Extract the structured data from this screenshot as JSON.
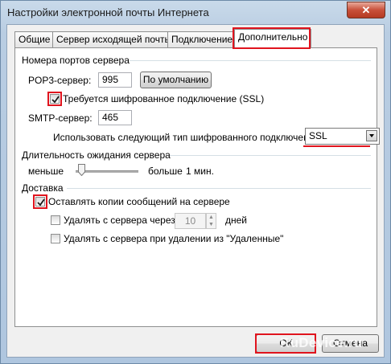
{
  "window": {
    "title": "Настройки электронной почты Интернета",
    "close_label": "✕"
  },
  "tabs": [
    {
      "label": "Общие"
    },
    {
      "label": "Сервер исходящей почты"
    },
    {
      "label": "Подключение"
    },
    {
      "label": "Дополнительно",
      "active": true
    }
  ],
  "ports": {
    "group_label": "Номера портов сервера",
    "pop3_label": "POP3-сервер:",
    "pop3_value": "995",
    "default_button": "По умолчанию",
    "ssl_required_label": "Требуется шифрованное подключение (SSL)",
    "ssl_required_checked": true,
    "smtp_label": "SMTP-сервер:",
    "smtp_value": "465",
    "encryption_label": "Использовать следующий тип шифрованного подключения:",
    "encryption_value": "SSL"
  },
  "timeout": {
    "group_label": "Длительность ожидания сервера",
    "less_label": "меньше",
    "more_label": "больше",
    "value_label": "1 мин.",
    "level": 0.05
  },
  "delivery": {
    "group_label": "Доставка",
    "keep_copies_label": "Оставлять копии сообщений на сервере",
    "keep_copies_checked": true,
    "remove_after_label": "Удалять с сервера через",
    "remove_after_checked": false,
    "days_value": "10",
    "days_label": "дней",
    "remove_deleted_label": "Удалять с сервера при удалении из \"Удаленные\"",
    "remove_deleted_checked": false
  },
  "footer": {
    "ok_label": "ОК",
    "cancel_label": "Отмена"
  },
  "watermark": "RuDevice.ru",
  "colors": {
    "highlight": "#e0141e",
    "frame": "#b9cde2"
  }
}
